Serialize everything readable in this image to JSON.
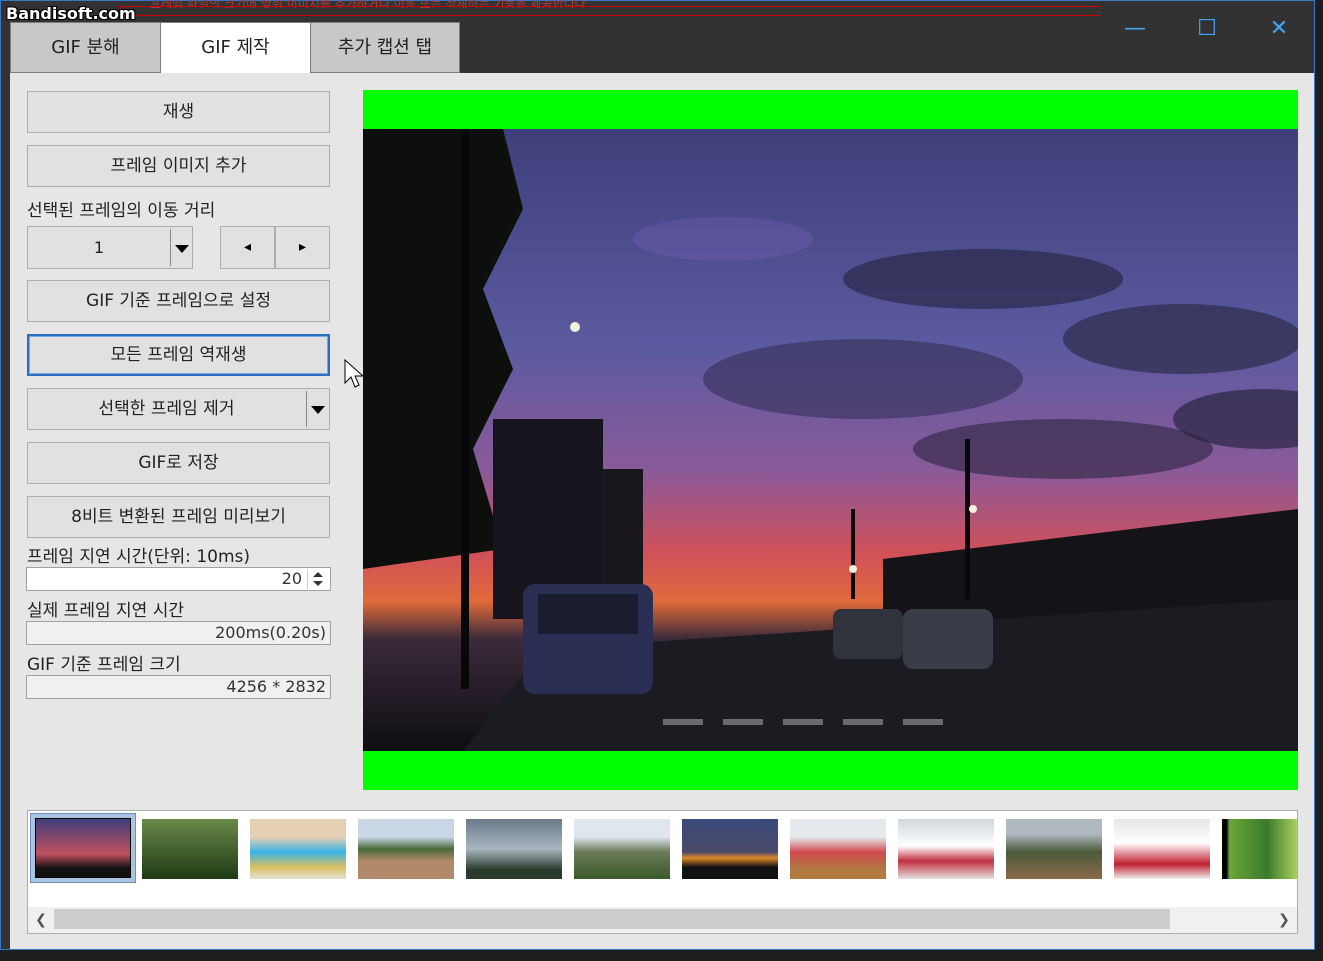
{
  "watermark": "Bandisoft.com",
  "background_text": "프레임 파일의 크기에 맞춰 이미지를 추가하거나 이동 또는 삭제하는 기능을 제공합니다",
  "window": {
    "minimize_icon": "minimize-icon",
    "maximize_icon": "maximize-icon",
    "close_icon": "close-icon"
  },
  "tabs": [
    {
      "label": "GIF 분해",
      "active": false
    },
    {
      "label": "GIF 제작",
      "active": true
    },
    {
      "label": "추가 캡션 탭",
      "active": false
    }
  ],
  "controls": {
    "play_label": "재생",
    "add_frame_label": "프레임 이미지 추가",
    "move_distance_label": "선택된 프레임의 이동 거리",
    "move_distance_value": "1",
    "prev_glyph": "◂",
    "next_glyph": "▸",
    "set_base_label": "GIF 기준 프레임으로 설정",
    "reverse_label": "모든 프레임 역재생",
    "remove_label": "선택한 프레임 제거",
    "save_label": "GIF로 저장",
    "preview8_label": "8비트 변환된 프레임 미리보기",
    "delay_label": "프레임 지연 시간(단위: 10ms)",
    "delay_value": "20",
    "actual_delay_label": "실제 프레임 지연 시간",
    "actual_delay_value": "200ms(0.20s)",
    "base_size_label": "GIF 기준 프레임 크기",
    "base_size_value": "4256 * 2832"
  },
  "thumbnails": [
    {
      "name": "sunset-street",
      "selected": true
    },
    {
      "name": "forest"
    },
    {
      "name": "blue-dessert"
    },
    {
      "name": "mountain-rock"
    },
    {
      "name": "cloudy-mountain"
    },
    {
      "name": "river-valley"
    },
    {
      "name": "dusk-sky"
    },
    {
      "name": "red-drink"
    },
    {
      "name": "cherry-dessert"
    },
    {
      "name": "valley-cliffs"
    },
    {
      "name": "cherry-glass"
    },
    {
      "name": "green-plant"
    }
  ],
  "colors": {
    "accent": "#2c6fc1",
    "preview_bg": "#00ff00",
    "titlebar": "#323232",
    "panel": "#e6e6e6"
  }
}
